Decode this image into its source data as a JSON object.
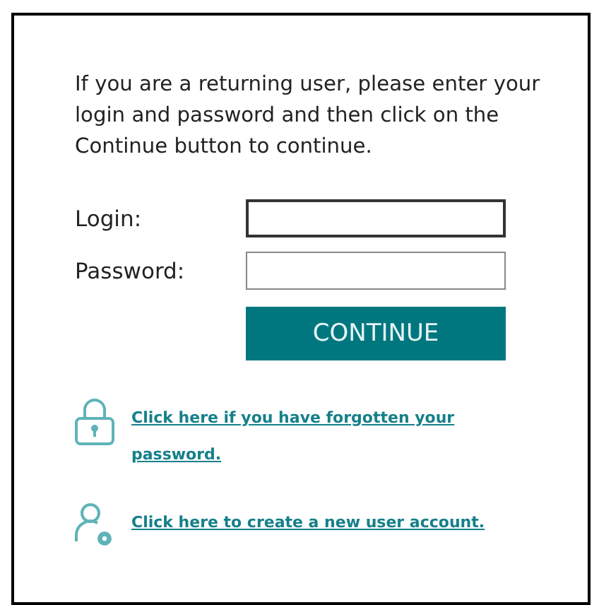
{
  "intro": "If you are a returning user, please enter your login and password and then click on the Continue button to continue.",
  "fields": [
    {
      "label": "Login:",
      "focused": true
    },
    {
      "label": "Password:",
      "focused": false
    }
  ],
  "submit_button": "CONTINUE",
  "links": [
    {
      "kind": "lock",
      "text": "Click here if you have forgotten your password."
    },
    {
      "kind": "user",
      "text": "Click here to create a new user account."
    }
  ]
}
